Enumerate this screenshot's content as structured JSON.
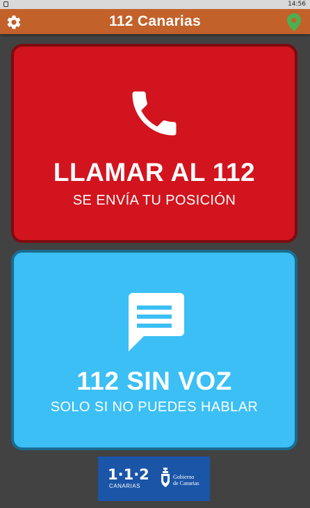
{
  "status_bar": {
    "time": "14:56"
  },
  "app_bar": {
    "title": "112 Canarias",
    "settings_icon": "gear-icon",
    "location_icon": "location-pin-icon",
    "location_color": "#4caf50"
  },
  "call_card": {
    "icon": "phone-icon",
    "title": "LLAMAR AL 112",
    "subtitle": "SE ENVÍA TU POSICIÓN",
    "background": "#d2141e"
  },
  "sms_card": {
    "icon": "message-icon",
    "title": "112 SIN VOZ",
    "subtitle": "SOLO SI NO PUEDES HABLAR",
    "background": "#3bbff5"
  },
  "footer_logo": {
    "emergency_number": "1·1·2",
    "emergency_region": "CANARIAS",
    "government_line1": "Gobierno",
    "government_line2": "de Canarias"
  }
}
